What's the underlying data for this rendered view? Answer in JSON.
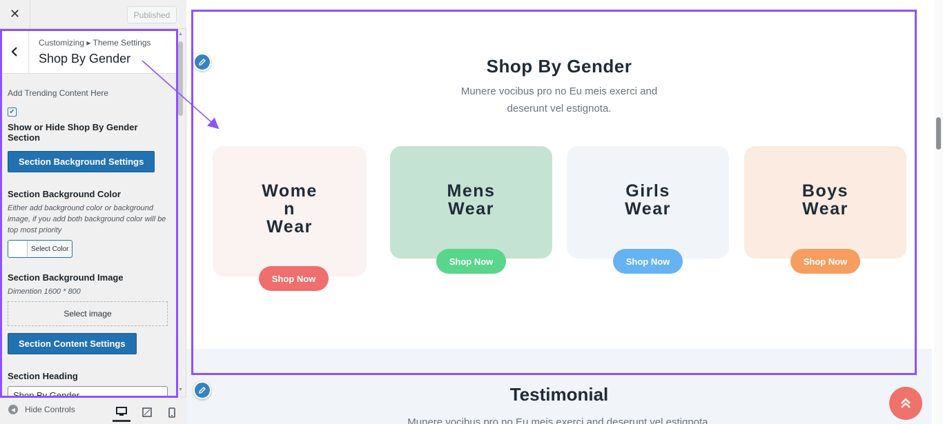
{
  "sidebar": {
    "published_label": "Published",
    "breadcrumb": "Customizing ▸ Theme Settings",
    "panel_title": "Shop By Gender",
    "trending_desc": "Add Trending Content Here",
    "show_hide_label": "Show or Hide Shop By Gender Section",
    "show_hide_checked": true,
    "bg_settings_button": "Section Background Settings",
    "bg_color_label": "Section Background Color",
    "bg_color_help": "Either add background color or background image, if you add both background color will be top most priority",
    "select_color_label": "Select Color",
    "bg_image_label": "Section Background Image",
    "bg_image_help": "Dimention 1600 * 800",
    "select_image_label": "Select image",
    "content_settings_button": "Section Content Settings",
    "heading_label": "Section Heading",
    "heading_value": "Shop By Gender",
    "hide_controls_label": "Hide Controls"
  },
  "preview": {
    "gender": {
      "title": "Shop By Gender",
      "subtitle": "Munere vocibus pro no Eu meis exerci and deserunt vel estignota.",
      "cards": [
        {
          "title": "Wome\nn\nWear",
          "button": "Shop Now",
          "bg": "#fbf2f2",
          "btn_color": "#ef6e6e"
        },
        {
          "title": "Mens\nWear",
          "button": "Shop Now",
          "bg": "#c5e3d2",
          "btn_color": "#5ad58c"
        },
        {
          "title": "Girls\nWear",
          "button": "Shop Now",
          "bg": "#f1f5f9",
          "btn_color": "#66b3f2"
        },
        {
          "title": "Boys\nWear",
          "button": "Shop Now",
          "bg": "#fbebe0",
          "btn_color": "#f59e60"
        }
      ]
    },
    "testimonial": {
      "title": "Testimonial",
      "subtitle": "Munere vocibus pro no Eu meis exerci and deserunt vel estignota."
    }
  },
  "colors": {
    "highlight": "#8c52ff",
    "primary_button": "#2271b1",
    "scroll_top": "#f0736b"
  }
}
